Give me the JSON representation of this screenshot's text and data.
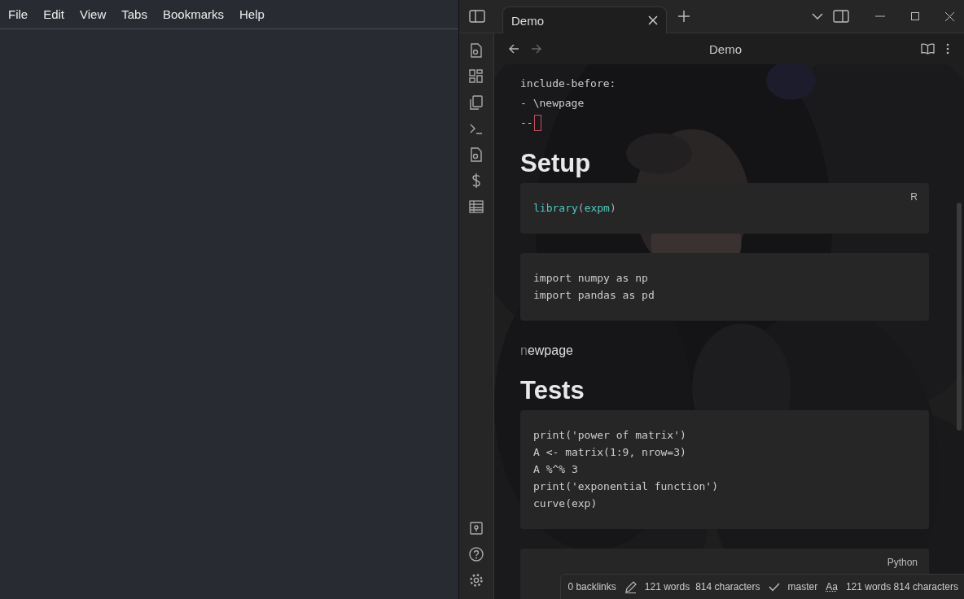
{
  "menu": [
    "File",
    "Edit",
    "View",
    "Tabs",
    "Bookmarks",
    "Help"
  ],
  "tabs": [
    {
      "label": "Demo",
      "selected": true
    }
  ],
  "header": {
    "title": "Demo"
  },
  "frontmatter": [
    "include-before:",
    " - \\newpage",
    "--"
  ],
  "blocks": [
    {
      "kind": "heading",
      "text": "Setup"
    },
    {
      "kind": "code",
      "lang": "R",
      "lines": [
        [
          {
            "kind": "name",
            "text": "library"
          },
          {
            "kind": "punct",
            "text": "("
          },
          {
            "kind": "name",
            "text": "expm"
          },
          {
            "kind": "punct",
            "text": ")"
          }
        ]
      ]
    },
    {
      "kind": "code",
      "lines": [
        [
          {
            "kind": "plain",
            "text": "import numpy as np"
          }
        ],
        [
          {
            "kind": "plain",
            "text": "import pandas as pd"
          }
        ]
      ]
    },
    {
      "kind": "para",
      "dim": "n",
      "text": "ewpage"
    },
    {
      "kind": "heading",
      "text": "Tests"
    },
    {
      "kind": "code",
      "lines": [
        [
          {
            "kind": "plain",
            "text": "print('power of matrix')"
          }
        ],
        [
          {
            "kind": "plain",
            "text": "A <- matrix(1:9, nrow=3)"
          }
        ],
        [
          {
            "kind": "plain",
            "text": "A %^% 3"
          }
        ],
        [
          {
            "kind": "plain",
            "text": "print('exponential function')"
          }
        ],
        [
          {
            "kind": "plain",
            "text": "curve(exp)"
          }
        ]
      ]
    },
    {
      "kind": "code",
      "lang": "Python"
    }
  ],
  "status_bar": {
    "backlinks": "0 backlinks",
    "words": "121 words",
    "characters": "814 characters",
    "branch": "master",
    "font": "Aa",
    "count": "121 words 814 characters"
  }
}
